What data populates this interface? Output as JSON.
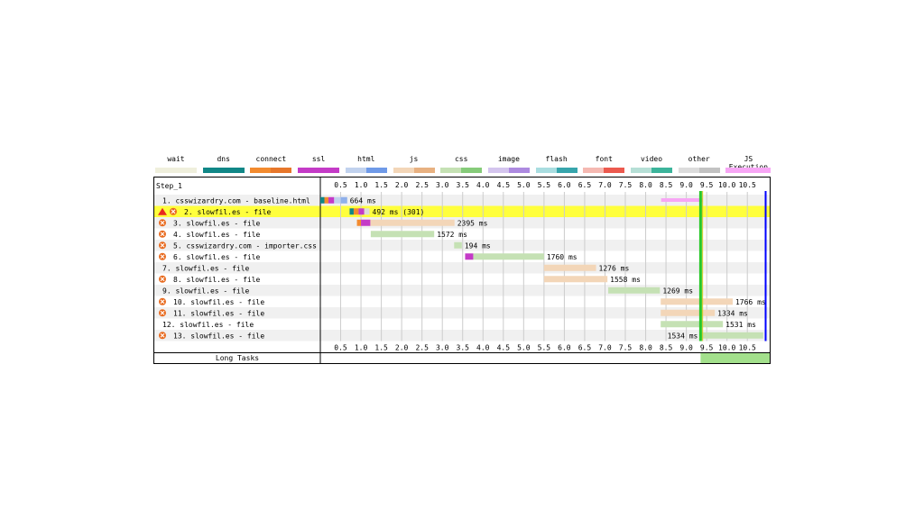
{
  "legend": [
    {
      "label": "wait",
      "colors": [
        "#efefdc",
        "#efefdc"
      ]
    },
    {
      "label": "dns",
      "colors": [
        "#118787",
        "#118787"
      ]
    },
    {
      "label": "connect",
      "colors": [
        "#f38b2f",
        "#e7772b"
      ]
    },
    {
      "label": "ssl",
      "colors": [
        "#c43bc7",
        "#c43bc7"
      ]
    },
    {
      "label": "html",
      "colors": [
        "#c1d2ee",
        "#6f9ae8"
      ]
    },
    {
      "label": "js",
      "colors": [
        "#f3d6b8",
        "#e8b181"
      ]
    },
    {
      "label": "css",
      "colors": [
        "#c5e1b4",
        "#86cb7a"
      ]
    },
    {
      "label": "image",
      "colors": [
        "#d4c5ee",
        "#ad8ae0"
      ]
    },
    {
      "label": "flash",
      "colors": [
        "#a9dde0",
        "#37a5ac"
      ]
    },
    {
      "label": "font",
      "colors": [
        "#f5b9b2",
        "#ec5a4f"
      ]
    },
    {
      "label": "video",
      "colors": [
        "#b6dfd6",
        "#3cb49b"
      ]
    },
    {
      "label": "other",
      "colors": [
        "#dcdcdc",
        "#c2c2c2"
      ]
    },
    {
      "label": "JS Execution",
      "colors": [
        "#f7a6f5",
        "#f7a6f5"
      ]
    }
  ],
  "chart_data": {
    "type": "waterfall",
    "title": "Step_1",
    "x_ticks": [
      0.5,
      1.0,
      1.5,
      2.0,
      2.5,
      3.0,
      3.5,
      4.0,
      4.5,
      5.0,
      5.5,
      6.0,
      6.5,
      7.0,
      7.5,
      8.0,
      8.5,
      9.0,
      9.5,
      10.0,
      10.5
    ],
    "x_tick_labels": [
      "0.5",
      "1.0",
      "1.5",
      "2.0",
      "2.5",
      "3.0",
      "3.5",
      "4.0",
      "4.5",
      "5.0",
      "5.5",
      "6.0",
      "6.5",
      "7.0",
      "7.5",
      "8.0",
      "8.5",
      "9.0",
      "9.5",
      "10.0",
      "10.5"
    ],
    "x_range": [
      0,
      11.05
    ],
    "rows": [
      {
        "label": "1. csswizardry.com - baseline.html",
        "status": "",
        "highlight": false,
        "phases": [
          {
            "t": "dns",
            "s": 0.0,
            "e": 0.1
          },
          {
            "t": "connect",
            "s": 0.1,
            "e": 0.2
          },
          {
            "t": "ssl",
            "s": 0.2,
            "e": 0.34
          },
          {
            "t": "html_wait",
            "s": 0.34,
            "e": 0.5
          },
          {
            "t": "html",
            "s": 0.5,
            "e": 0.66
          }
        ],
        "duration": "664 ms"
      },
      {
        "label": "2. slowfil.es - file",
        "status": "warn-error",
        "highlight": true,
        "phases": [
          {
            "t": "dns",
            "s": 0.72,
            "e": 0.82
          },
          {
            "t": "connect",
            "s": 0.82,
            "e": 0.94
          },
          {
            "t": "ssl",
            "s": 0.94,
            "e": 1.08
          },
          {
            "t": "other_wait",
            "s": 1.08,
            "e": 1.21
          }
        ],
        "duration": "492 ms (301)"
      },
      {
        "label": "3. slowfil.es - file",
        "status": "error",
        "highlight": false,
        "phases": [
          {
            "t": "connect",
            "s": 0.9,
            "e": 1.0
          },
          {
            "t": "ssl",
            "s": 1.0,
            "e": 1.23
          },
          {
            "t": "js_wait",
            "s": 1.23,
            "e": 3.3
          }
        ],
        "duration": "2395 ms"
      },
      {
        "label": "4. slowfil.es - file",
        "status": "error",
        "highlight": false,
        "phases": [
          {
            "t": "css_wait",
            "s": 1.24,
            "e": 2.8
          }
        ],
        "duration": "1572 ms"
      },
      {
        "label": "5. csswizardry.com - importer.css",
        "status": "error",
        "highlight": false,
        "phases": [
          {
            "t": "css_wait",
            "s": 3.29,
            "e": 3.48
          }
        ],
        "duration": "194 ms"
      },
      {
        "label": "6. slowfil.es - file",
        "status": "error",
        "highlight": false,
        "phases": [
          {
            "t": "ssl",
            "s": 3.56,
            "e": 3.76
          },
          {
            "t": "css_wait",
            "s": 3.76,
            "e": 5.5
          }
        ],
        "duration": "1760 ms"
      },
      {
        "label": "7. slowfil.es - file",
        "status": "",
        "highlight": false,
        "phases": [
          {
            "t": "js_wait",
            "s": 5.5,
            "e": 6.78
          }
        ],
        "duration": "1276 ms"
      },
      {
        "label": "8. slowfil.es - file",
        "status": "error",
        "highlight": false,
        "phases": [
          {
            "t": "js_wait",
            "s": 5.5,
            "e": 7.06
          }
        ],
        "duration": "1558 ms"
      },
      {
        "label": "9. slowfil.es - file",
        "status": "",
        "highlight": false,
        "phases": [
          {
            "t": "css_wait",
            "s": 7.08,
            "e": 8.35
          }
        ],
        "duration": "1269 ms"
      },
      {
        "label": "10. slowfil.es - file",
        "status": "error",
        "highlight": false,
        "phases": [
          {
            "t": "js_wait",
            "s": 8.37,
            "e": 10.14
          }
        ],
        "duration": "1766 ms"
      },
      {
        "label": "11. slowfil.es - file",
        "status": "error",
        "highlight": false,
        "phases": [
          {
            "t": "js_wait",
            "s": 8.37,
            "e": 9.7
          }
        ],
        "duration": "1334 ms"
      },
      {
        "label": "12. slowfil.es - file",
        "status": "",
        "highlight": false,
        "phases": [
          {
            "t": "css_wait",
            "s": 8.37,
            "e": 9.9
          }
        ],
        "duration": "1531 ms"
      },
      {
        "label": "13. slowfil.es - file",
        "status": "error",
        "highlight": false,
        "phases": [
          {
            "t": "css_wait",
            "s": 9.35,
            "e": 10.89
          }
        ],
        "duration": "1534 ms",
        "duration_side": "left"
      }
    ],
    "js_execution": [
      {
        "s": 8.38,
        "e": 9.4
      }
    ],
    "markers": [
      {
        "t": 9.35,
        "color": "#28c828",
        "width": 3
      },
      {
        "t": 9.4,
        "color": "#c8c81e",
        "width": 1
      },
      {
        "t": 10.95,
        "color": "#0000ff",
        "width": 2
      }
    ],
    "long_tasks_label": "Long Tasks",
    "long_tasks": [
      {
        "s": 9.35,
        "e": 11.05
      }
    ]
  }
}
